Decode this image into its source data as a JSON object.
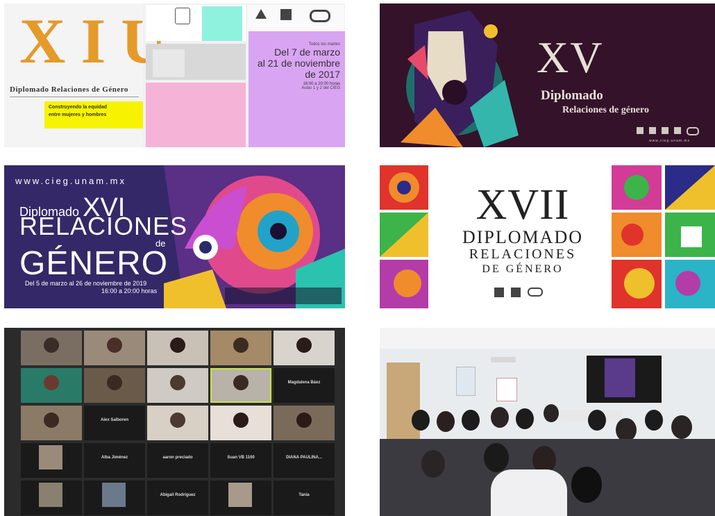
{
  "tile_1": {
    "numeral": "XIU",
    "subtitle": "Diplomado Relaciones de Género",
    "slogan_line1": "Construyendo la equidad",
    "slogan_line2": "entre mujeres y hombres",
    "schedule_note": "Todos los martes",
    "dates_line1": "Del 7 de marzo",
    "dates_line2": "al 21 de noviembre",
    "dates_line3": "de 2017",
    "hours": "16:00 a 20:00 horas",
    "room": "Aulas 1 y 2 del CIEG"
  },
  "tile_2": {
    "numeral": "XV",
    "title": "Diplomado",
    "subtitle": "Relaciones de género",
    "url": "www.cieg.unam.mx"
  },
  "tile_3": {
    "url": "www.cieg.unam.mx",
    "diplomado": "Diplomado",
    "numeral": "XVI",
    "relaciones": "RELACIONES",
    "de": "de",
    "genero": "GÉNERO",
    "dates": "Del 5 de marzo al 26 de noviembre de 2019",
    "hours": "16:00 a 20:00 horas"
  },
  "tile_4": {
    "numeral": "XVII",
    "line1": "DIPLOMADO",
    "line2": "RELACIONES",
    "line3": "DE GÉNERO"
  },
  "tile_5": {
    "participants": [
      "Magdalena Báez",
      "Alex Salboren",
      "Alba Jiménez",
      "aaron preciado",
      "Suan VB 1100",
      "DIANA PAULINA...",
      "Abigail Rodríguez",
      "Tania"
    ]
  },
  "colors": {
    "xiu_orange": "#e59a2a",
    "xv_background": "#34122a",
    "xv_text": "#e6e1d4",
    "xiu_yellow": "#f7f300",
    "xiu_pink": "#f5b3d8",
    "xiu_lilac": "#d9a4f2",
    "xiu_mint": "#8ef2df"
  }
}
